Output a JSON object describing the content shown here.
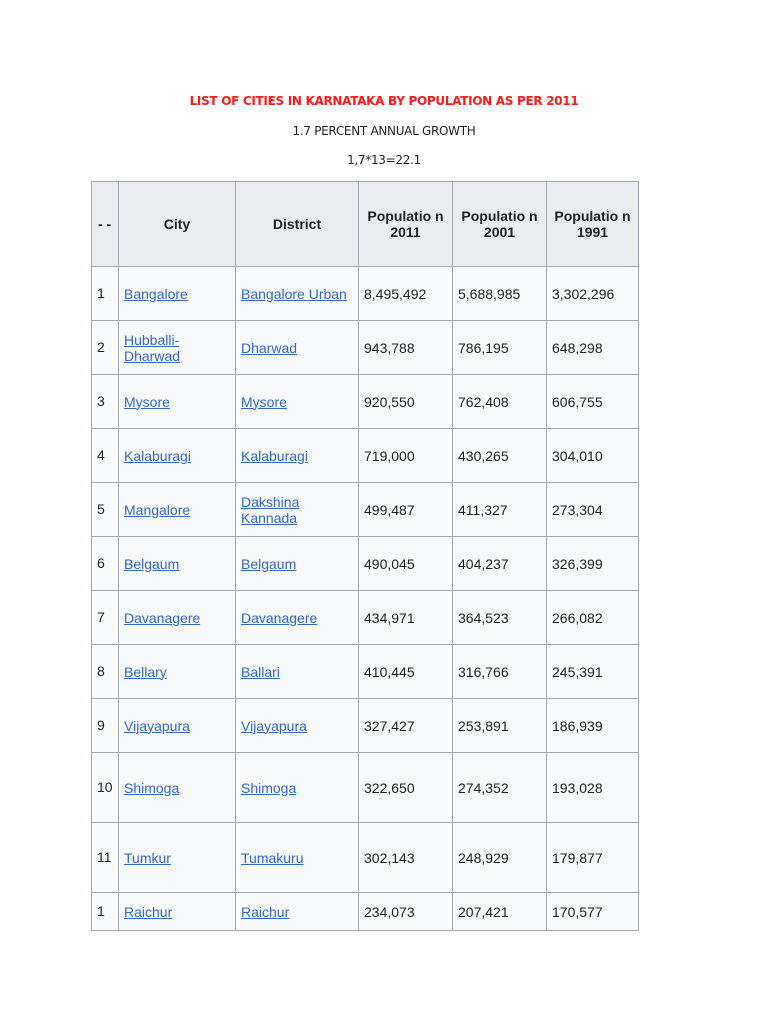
{
  "title": "LIST OF CITIES IN KARNATAKA BY POPULATION AS PER 2011",
  "growth_note": "1.7 PERCENT ANNUAL GROWTH",
  "formula": "1,7*13=22.1",
  "table": {
    "headers": [
      "- -",
      "City",
      "District",
      "Populatio n 2011",
      "Populatio n 2001",
      "Populatio n 1991"
    ],
    "rows": [
      {
        "no": "1",
        "city": "Bangalore",
        "district": "Bangalore Urban",
        "p2011": "8,495,492",
        "p2001": "5,688,985",
        "p1991": "3,302,296"
      },
      {
        "no": "2",
        "city": "Hubballi-Dharwad",
        "district": "Dharwad",
        "p2011": "943,788",
        "p2001": "786,195",
        "p1991": "648,298"
      },
      {
        "no": "3",
        "city": "Mysore",
        "district": "Mysore",
        "p2011": "920,550",
        "p2001": "762,408",
        "p1991": "606,755"
      },
      {
        "no": "4",
        "city": "Kalaburagi",
        "district": "Kalaburagi",
        "p2011": "719,000",
        "p2001": "430,265",
        "p1991": "304,010"
      },
      {
        "no": "5",
        "city": "Mangalore",
        "district": "Dakshina Kannada",
        "p2011": "499,487",
        "p2001": "411,327",
        "p1991": "273,304"
      },
      {
        "no": "6",
        "city": "Belgaum",
        "district": "Belgaum",
        "p2011": "490,045",
        "p2001": "404,237",
        "p1991": "326,399"
      },
      {
        "no": "7",
        "city": "Davanagere",
        "district": "Davanagere",
        "p2011": "434,971",
        "p2001": "364,523",
        "p1991": "266,082"
      },
      {
        "no": "8",
        "city": "Bellary",
        "district": "Ballari",
        "p2011": "410,445",
        "p2001": "316,766",
        "p1991": "245,391"
      },
      {
        "no": "9",
        "city": "Vijayapura",
        "district": "Vijayapura",
        "p2011": "327,427",
        "p2001": "253,891",
        "p1991": "186,939"
      },
      {
        "no": "10",
        "city": "Shimoga",
        "district": "Shimoga",
        "p2011": "322,650",
        "p2001": "274,352",
        "p1991": "193,028"
      },
      {
        "no": "11",
        "city": "Tumkur",
        "district": "Tumakuru",
        "p2011": "302,143",
        "p2001": "248,929",
        "p1991": "179,877"
      },
      {
        "no": "1",
        "city": "Raichur",
        "district": "Raichur",
        "p2011": "234,073",
        "p2001": "207,421",
        "p1991": "170,577"
      }
    ]
  }
}
